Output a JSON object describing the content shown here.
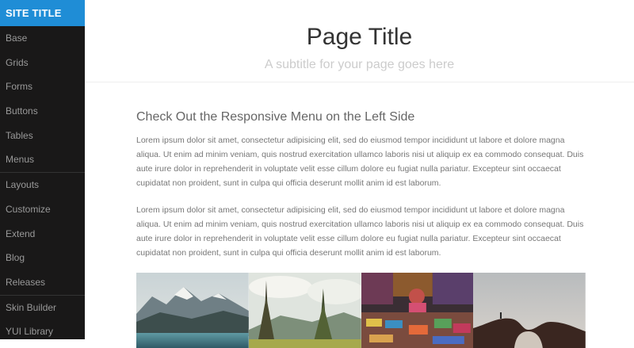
{
  "sidebar": {
    "site_title": "SITE TITLE",
    "items": [
      {
        "label": "Base"
      },
      {
        "label": "Grids"
      },
      {
        "label": "Forms"
      },
      {
        "label": "Buttons"
      },
      {
        "label": "Tables"
      },
      {
        "label": "Menus"
      },
      {
        "label": "Layouts"
      },
      {
        "label": "Customize"
      },
      {
        "label": "Extend"
      },
      {
        "label": "Blog"
      },
      {
        "label": "Releases"
      },
      {
        "label": "Skin Builder"
      },
      {
        "label": "YUI Library"
      }
    ]
  },
  "header": {
    "title": "Page Title",
    "subtitle": "A subtitle for your page goes here"
  },
  "content": {
    "subhead": "Check Out the Responsive Menu on the Left Side",
    "paragraphs": [
      "Lorem ipsum dolor sit amet, consectetur adipisicing elit, sed do eiusmod tempor incididunt ut labore et dolore magna aliqua. Ut enim ad minim veniam, quis nostrud exercitation ullamco laboris nisi ut aliquip ex ea commodo consequat. Duis aute irure dolor in reprehenderit in voluptate velit esse cillum dolore eu fugiat nulla pariatur. Excepteur sint occaecat cupidatat non proident, sunt in culpa qui officia deserunt mollit anim id est laborum.",
      "Lorem ipsum dolor sit amet, consectetur adipisicing elit, sed do eiusmod tempor incididunt ut labore et dolore magna aliqua. Ut enim ad minim veniam, quis nostrud exercitation ullamco laboris nisi ut aliquip ex ea commodo consequat. Duis aute irure dolor in reprehenderit in voluptate velit esse cillum dolore eu fugiat nulla pariatur. Excepteur sint occaecat cupidatat non proident, sunt in culpa qui officia deserunt mollit anim id est laborum."
    ]
  },
  "colors": {
    "sidebar_bg": "#191818",
    "accent": "#1f8dd6",
    "menu_text": "#999999"
  }
}
